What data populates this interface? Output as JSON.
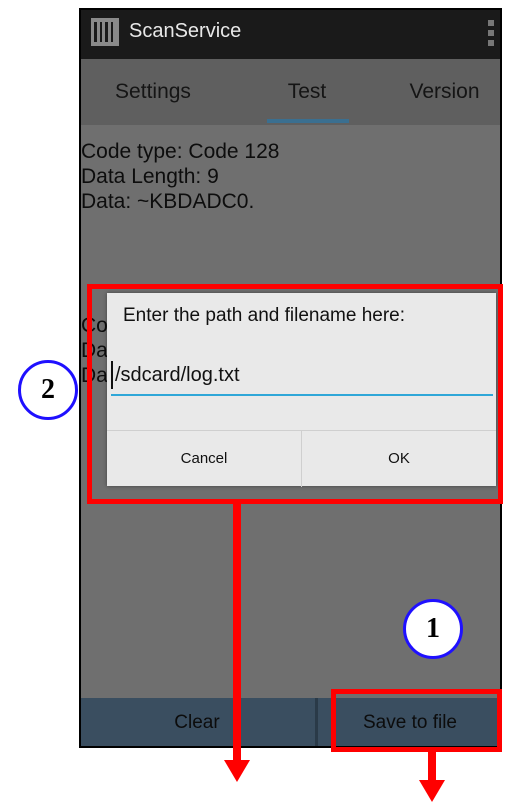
{
  "app": {
    "title": "ScanService"
  },
  "tabs": [
    {
      "label": "Settings"
    },
    {
      "label": "Test"
    },
    {
      "label": "Version"
    }
  ],
  "scan": {
    "lines": [
      "Code type: Code 128",
      "Data Length: 9",
      "Data: ~KBDADC0."
    ]
  },
  "scan_partial": {
    "lines": [
      "Co",
      "Da",
      "Da"
    ]
  },
  "dialog": {
    "title": "Enter the path and filename here:",
    "input_value": "/sdcard/log.txt",
    "cancel_label": "Cancel",
    "ok_label": "OK"
  },
  "bottom": {
    "clear_label": "Clear",
    "save_label": "Save to file"
  },
  "callouts": {
    "one": "1",
    "two": "2"
  },
  "colors": {
    "highlight": "#ff0000",
    "callout_border": "#1f10ff",
    "input_underline": "#2fa7d8"
  }
}
